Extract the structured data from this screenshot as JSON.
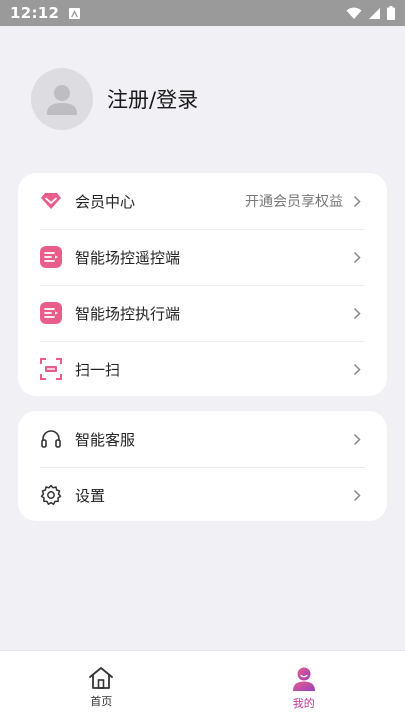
{
  "status_bar": {
    "time": "12:12"
  },
  "profile": {
    "name": "注册/登录"
  },
  "menu_group_1": [
    {
      "label": "会员中心",
      "sub": "开通会员享权益",
      "icon": "diamond-icon"
    },
    {
      "label": "智能场控遥控端",
      "icon": "remote-control-icon"
    },
    {
      "label": "智能场控执行端",
      "icon": "executor-icon"
    },
    {
      "label": "扫一扫",
      "icon": "scan-icon"
    }
  ],
  "menu_group_2": [
    {
      "label": "智能客服",
      "icon": "headset-icon"
    },
    {
      "label": "设置",
      "icon": "gear-icon"
    }
  ],
  "bottom_nav": [
    {
      "label": "首页",
      "icon": "home-icon",
      "active": false
    },
    {
      "label": "我的",
      "icon": "profile-icon",
      "active": true
    }
  ],
  "colors": {
    "accent_pink": "#e85d8a",
    "active_nav": "#c2389a",
    "background": "#f1f0f5"
  }
}
